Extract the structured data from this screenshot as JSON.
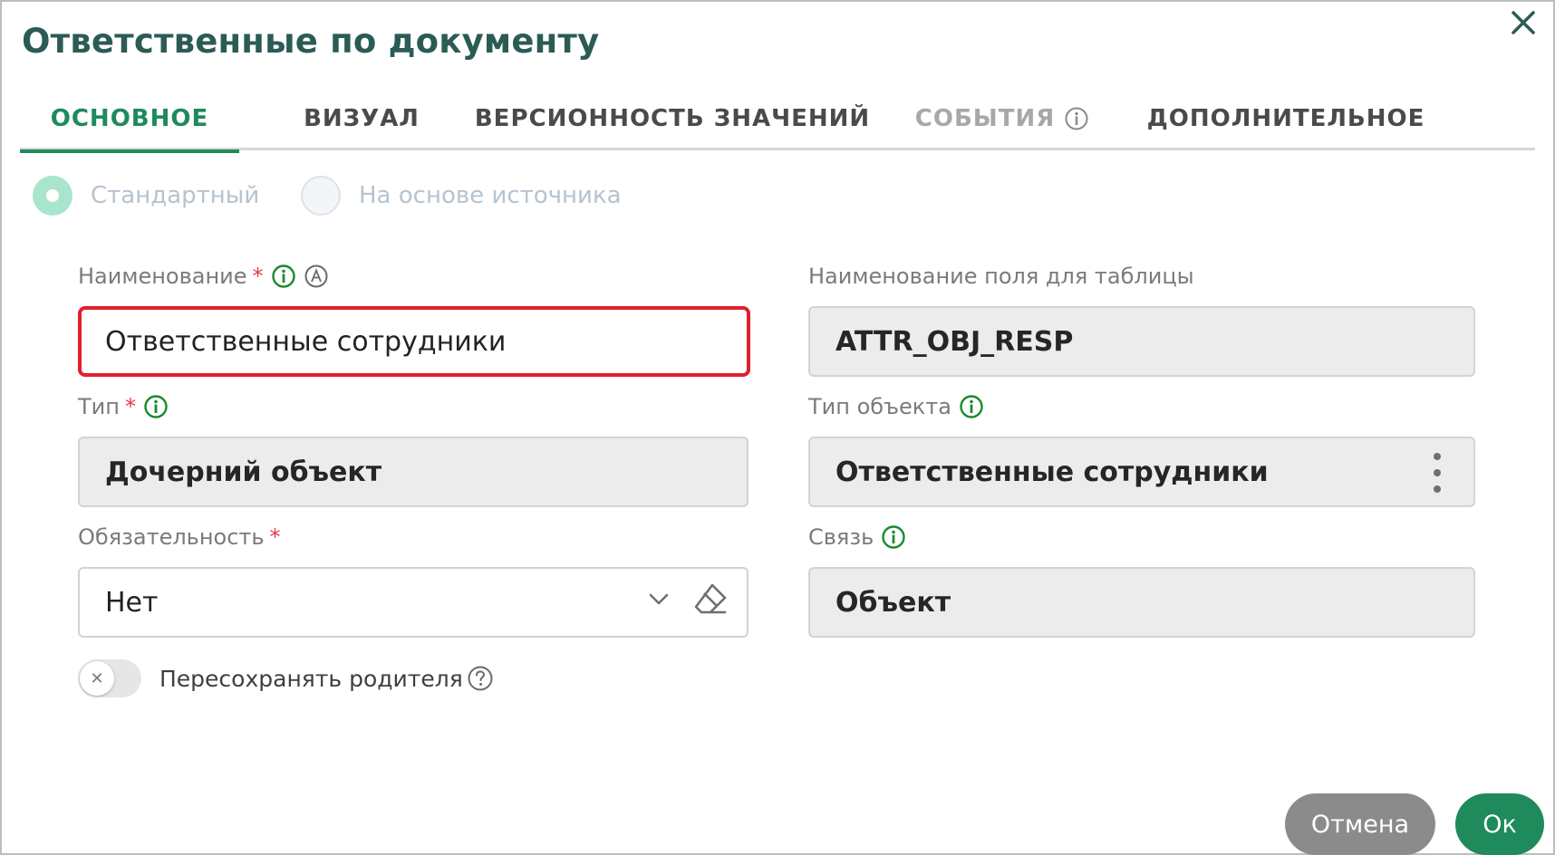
{
  "dialog": {
    "title": "Ответственные по документу"
  },
  "tabs": [
    {
      "label": "ОСНОВНОЕ",
      "state": "active"
    },
    {
      "label": "ВИЗУАЛ",
      "state": "normal"
    },
    {
      "label": "ВЕРСИОННОСТЬ ЗНАЧЕНИЙ",
      "state": "normal"
    },
    {
      "label": "СОБЫТИЯ",
      "state": "disabled",
      "icon": "info-icon"
    },
    {
      "label": "ДОПОЛНИТЕЛЬНОЕ",
      "state": "normal"
    }
  ],
  "mode": {
    "options": [
      {
        "label": "Стандартный",
        "selected": true
      },
      {
        "label": "На основе источника",
        "selected": false
      }
    ]
  },
  "fields": {
    "name": {
      "label": "Наименование",
      "required": "*",
      "value": "Ответственные сотрудники",
      "icons": [
        "info-icon",
        "auto-translate-icon"
      ],
      "state": "error"
    },
    "table_field_name": {
      "label": "Наименование поля для таблицы",
      "value": "ATTR_OBJ_RESP"
    },
    "type": {
      "label": "Тип",
      "required": "*",
      "value": "Дочерний объект",
      "icons": [
        "info-icon"
      ]
    },
    "object_type": {
      "label": "Тип объекта",
      "value": "Ответственные сотрудники",
      "icons": [
        "info-icon",
        "more-vertical-icon"
      ]
    },
    "mandatory": {
      "label": "Обязательность",
      "required": "*",
      "value": "Нет",
      "icons": [
        "chevron-down-icon",
        "eraser-icon"
      ]
    },
    "link": {
      "label": "Связь",
      "value": "Объект",
      "icons": [
        "info-icon"
      ]
    }
  },
  "toggle": {
    "label": "Пересохранять родителя",
    "on": false,
    "icon": "help-icon"
  },
  "buttons": {
    "cancel": "Отмена",
    "ok": "Ок"
  },
  "colors": {
    "accent": "#1f8a5b",
    "title": "#2b5b55",
    "error": "#e01f2e",
    "required": "#e43a4a",
    "cancel": "#8b8b8b"
  }
}
